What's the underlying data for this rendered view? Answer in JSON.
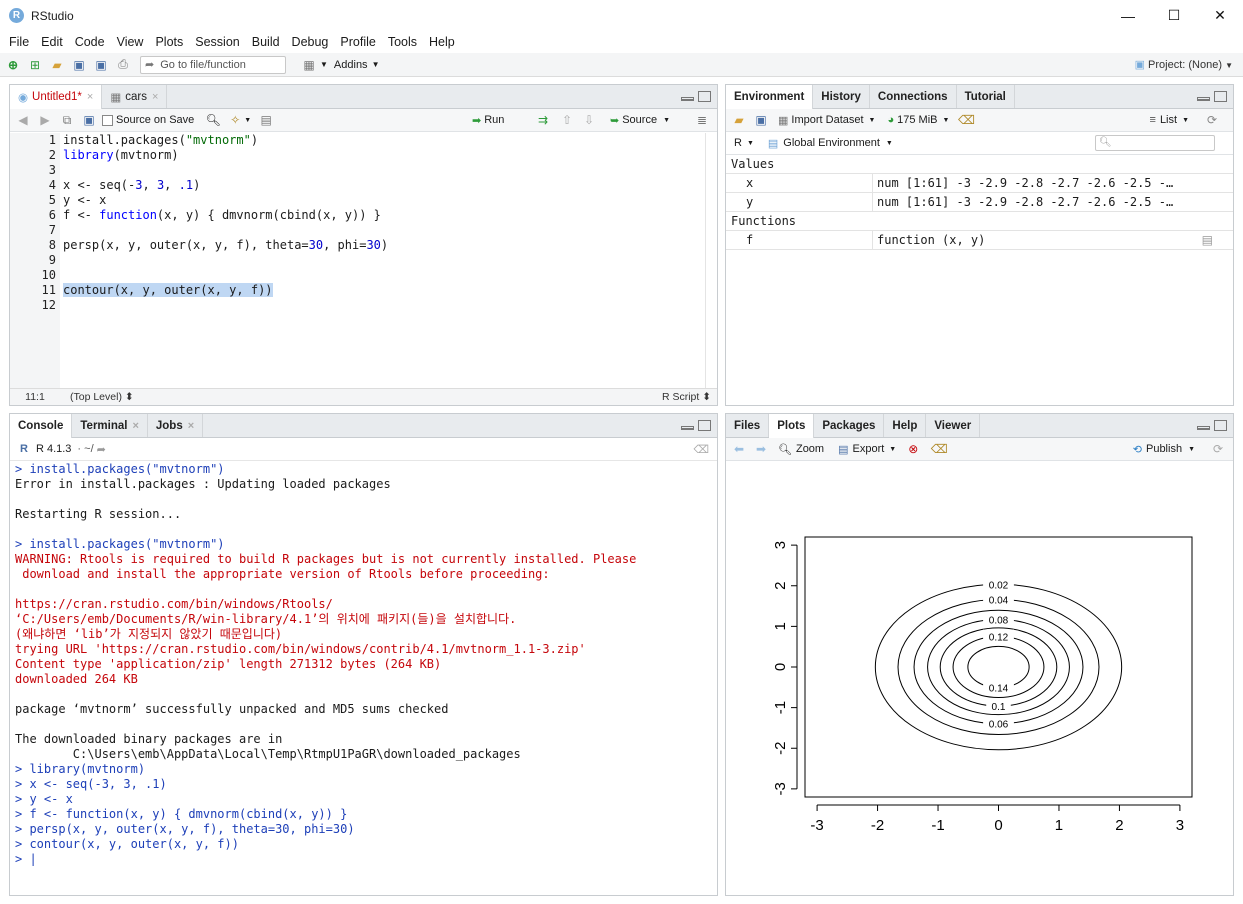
{
  "app": {
    "title": "RStudio",
    "logo": "R"
  },
  "window_controls": {
    "minimize": "—",
    "maximize": "☐",
    "close": "✕"
  },
  "menu": [
    "File",
    "Edit",
    "Code",
    "View",
    "Plots",
    "Session",
    "Build",
    "Debug",
    "Profile",
    "Tools",
    "Help"
  ],
  "toolbar": {
    "goto_placeholder": "Go to file/function",
    "addins": "Addins",
    "project": "Project: (None)"
  },
  "editor": {
    "tabs": [
      {
        "label": "Untitled1*",
        "close": "×"
      },
      {
        "label": "cars",
        "close": "×"
      }
    ],
    "source_on_save": "Source on Save",
    "run": "Run",
    "source": "Source",
    "line_numbers": [
      "1",
      "2",
      "3",
      "4",
      "5",
      "6",
      "7",
      "8",
      "9",
      "10",
      "11",
      "12"
    ],
    "status_position": "11:1",
    "status_scope": "(Top Level) ⬍",
    "status_type": "R Script ⬍",
    "code": {
      "l1a": "install.packages(",
      "l1b": "\"mvtnorm\"",
      "l1c": ")",
      "l2a": "library",
      "l2b": "(mvtnorm)",
      "l4a": "x <- seq(-",
      "l4b": "3",
      "l4c": ", ",
      "l4d": "3",
      "l4e": ", ",
      "l4f": ".1",
      "l4g": ")",
      "l5": "y <- x",
      "l6a": "f <- ",
      "l6b": "function",
      "l6c": "(x, y) { dmvnorm(cbind(x, y)) }",
      "l8a": "persp(x, y, outer(x, y, f), theta=",
      "l8b": "30",
      "l8c": ", phi=",
      "l8d": "30",
      "l8e": ")",
      "l11": "contour(x, y, outer(x, y, f))"
    }
  },
  "environment": {
    "tabs": [
      "Environment",
      "History",
      "Connections",
      "Tutorial"
    ],
    "import_dataset": "Import Dataset",
    "memory": "175 MiB",
    "list": "List",
    "lang": "R",
    "scope": "Global Environment",
    "sections": {
      "values": "Values",
      "functions": "Functions"
    },
    "values": [
      {
        "name": "x",
        "value": "num [1:61] -3 -2.9 -2.8 -2.7 -2.6 -2.5 -…"
      },
      {
        "name": "y",
        "value": "num [1:61] -3 -2.9 -2.8 -2.7 -2.6 -2.5 -…"
      }
    ],
    "functions": [
      {
        "name": "f",
        "value": "function (x, y)"
      }
    ]
  },
  "console": {
    "tabs": [
      {
        "label": "Console"
      },
      {
        "label": "Terminal",
        "close": "×"
      },
      {
        "label": "Jobs",
        "close": "×"
      }
    ],
    "version": "R 4.1.3",
    "path": "· ~/",
    "lines": [
      {
        "t": "in",
        "s": "> install.packages(\"mvtnorm\")"
      },
      {
        "t": "out",
        "s": "Error in install.packages : Updating loaded packages"
      },
      {
        "t": "out",
        "s": ""
      },
      {
        "t": "out",
        "s": "Restarting R session..."
      },
      {
        "t": "out",
        "s": ""
      },
      {
        "t": "in",
        "s": "> install.packages(\"mvtnorm\")"
      },
      {
        "t": "err",
        "s": "WARNING: Rtools is required to build R packages but is not currently installed. Please"
      },
      {
        "t": "err",
        "s": " download and install the appropriate version of Rtools before proceeding:"
      },
      {
        "t": "err",
        "s": ""
      },
      {
        "t": "err",
        "s": "https://cran.rstudio.com/bin/windows/Rtools/"
      },
      {
        "t": "err",
        "s": "‘C:/Users/emb/Documents/R/win-library/4.1’의 위치에 패키지(들)을 설치합니다."
      },
      {
        "t": "err",
        "s": "(왜냐하면 ‘lib’가 지정되지 않았기 때문입니다)"
      },
      {
        "t": "err",
        "s": "trying URL 'https://cran.rstudio.com/bin/windows/contrib/4.1/mvtnorm_1.1-3.zip'"
      },
      {
        "t": "err",
        "s": "Content type 'application/zip' length 271312 bytes (264 KB)"
      },
      {
        "t": "err",
        "s": "downloaded 264 KB"
      },
      {
        "t": "out",
        "s": ""
      },
      {
        "t": "out",
        "s": "package ‘mvtnorm’ successfully unpacked and MD5 sums checked"
      },
      {
        "t": "out",
        "s": ""
      },
      {
        "t": "out",
        "s": "The downloaded binary packages are in"
      },
      {
        "t": "out",
        "s": "        C:\\Users\\emb\\AppData\\Local\\Temp\\RtmpU1PaGR\\downloaded_packages"
      },
      {
        "t": "in",
        "s": "> library(mvtnorm)"
      },
      {
        "t": "in",
        "s": "> x <- seq(-3, 3, .1)"
      },
      {
        "t": "in",
        "s": "> y <- x"
      },
      {
        "t": "in",
        "s": "> f <- function(x, y) { dmvnorm(cbind(x, y)) }"
      },
      {
        "t": "in",
        "s": "> persp(x, y, outer(x, y, f), theta=30, phi=30)"
      },
      {
        "t": "in",
        "s": "> contour(x, y, outer(x, y, f))"
      },
      {
        "t": "in",
        "s": "> |"
      }
    ]
  },
  "plots": {
    "tabs": [
      "Files",
      "Plots",
      "Packages",
      "Help",
      "Viewer"
    ],
    "zoom": "Zoom",
    "export": "Export",
    "publish": "Publish"
  },
  "chart_data": {
    "type": "contour",
    "x_ticks": [
      "-3",
      "-2",
      "-1",
      "0",
      "1",
      "2",
      "3"
    ],
    "y_ticks": [
      "-3",
      "-2",
      "-1",
      "0",
      "1",
      "2",
      "3"
    ],
    "xlim": [
      -3.2,
      3.2
    ],
    "ylim": [
      -3.2,
      3.2
    ],
    "levels": [
      0.02,
      0.04,
      0.06,
      0.08,
      0.1,
      0.12,
      0.14
    ],
    "level_labels": [
      "0.02",
      "0.04",
      "0.06",
      "0.08",
      "0.1",
      "0.12",
      "0.14"
    ],
    "labelled_levels_top": [
      "0.02",
      "0.04",
      "0.08",
      "0.12"
    ],
    "labelled_levels_bottom": [
      "0.14",
      "0.1",
      "0.06"
    ]
  }
}
